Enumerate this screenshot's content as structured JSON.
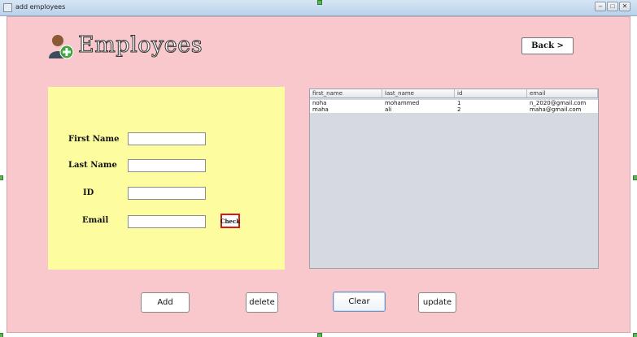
{
  "window": {
    "title": "add employees",
    "controls": [
      "–",
      "□",
      "✕"
    ]
  },
  "header": {
    "title": "Employees",
    "back_label": "Back  >"
  },
  "form": {
    "first_name_label": "First Name",
    "last_name_label": "Last Name",
    "id_label": "ID",
    "email_label": "Email",
    "check_label": "Check",
    "first_name_value": "",
    "last_name_value": "",
    "id_value": "",
    "email_value": ""
  },
  "table": {
    "columns": [
      "first_name",
      "last_name",
      "id",
      "email"
    ],
    "rows": [
      [
        "noha",
        "mohammed",
        "1",
        "n_2020@gmail.com"
      ],
      [
        "maha",
        "ali",
        "2",
        "maha@gmail.com"
      ]
    ]
  },
  "actions": {
    "add": "Add",
    "delete": "delete",
    "clear": "Clear",
    "update": "update"
  },
  "colors": {
    "background": "#f8c8cc",
    "form_panel": "#fdfda0",
    "table_bg": "#d6d9e0",
    "check_border": "#d21c1c"
  }
}
